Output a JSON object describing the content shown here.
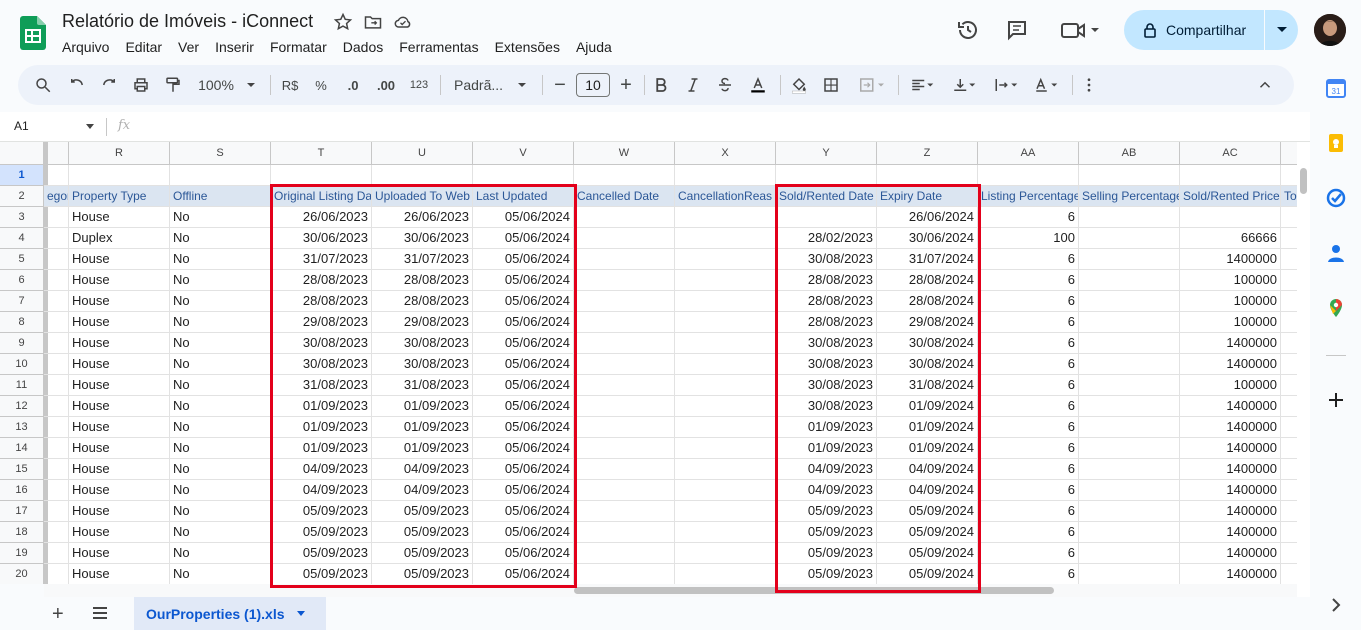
{
  "doc": {
    "title": "Relatório de Imóveis - iConnect"
  },
  "menu": [
    "Arquivo",
    "Editar",
    "Ver",
    "Inserir",
    "Formatar",
    "Dados",
    "Ferramentas",
    "Extensões",
    "Ajuda"
  ],
  "share": {
    "label": "Compartilhar"
  },
  "toolbar": {
    "zoom": "100%",
    "currency": "R$",
    "percent": "%",
    "dec_less": ".0",
    "dec_more": ".00",
    "number_format": "123",
    "font": "Padrã...",
    "font_size": "10",
    "minus": "−",
    "plus": "+"
  },
  "namebox": "A1",
  "fx": "fx",
  "columns": [
    "",
    "R",
    "S",
    "T",
    "U",
    "V",
    "W",
    "X",
    "Y",
    "Z",
    "AA",
    "AB",
    "AC"
  ],
  "header_row": [
    "egory",
    "Property Type",
    "Offline",
    "Original Listing Da",
    "Uploaded To Web",
    "Last Updated",
    "Cancelled Date",
    "CancellationReas",
    "Sold/Rented Date",
    "Expiry Date",
    "Listing Percentage",
    "Selling Percentage",
    "Sold/Rented Price",
    "To"
  ],
  "rows": [
    {
      "n": "1",
      "c": [
        "",
        "",
        "",
        "",
        "",
        "",
        "",
        "",
        "",
        "",
        "",
        "",
        ""
      ]
    },
    {
      "n": "3",
      "c": [
        "",
        "House",
        "No",
        "26/06/2023",
        "26/06/2023",
        "05/06/2024",
        "",
        "",
        "",
        "26/06/2024",
        "6",
        "",
        ""
      ]
    },
    {
      "n": "4",
      "c": [
        "",
        "Duplex",
        "No",
        "30/06/2023",
        "30/06/2023",
        "05/06/2024",
        "",
        "",
        "28/02/2023",
        "30/06/2024",
        "100",
        "",
        "66666"
      ]
    },
    {
      "n": "5",
      "c": [
        "",
        "House",
        "No",
        "31/07/2023",
        "31/07/2023",
        "05/06/2024",
        "",
        "",
        "30/08/2023",
        "31/07/2024",
        "6",
        "",
        "1400000"
      ]
    },
    {
      "n": "6",
      "c": [
        "",
        "House",
        "No",
        "28/08/2023",
        "28/08/2023",
        "05/06/2024",
        "",
        "",
        "28/08/2023",
        "28/08/2024",
        "6",
        "",
        "100000"
      ]
    },
    {
      "n": "7",
      "c": [
        "",
        "House",
        "No",
        "28/08/2023",
        "28/08/2023",
        "05/06/2024",
        "",
        "",
        "28/08/2023",
        "28/08/2024",
        "6",
        "",
        "100000"
      ]
    },
    {
      "n": "8",
      "c": [
        "",
        "House",
        "No",
        "29/08/2023",
        "29/08/2023",
        "05/06/2024",
        "",
        "",
        "28/08/2023",
        "29/08/2024",
        "6",
        "",
        "100000"
      ]
    },
    {
      "n": "9",
      "c": [
        "",
        "House",
        "No",
        "30/08/2023",
        "30/08/2023",
        "05/06/2024",
        "",
        "",
        "30/08/2023",
        "30/08/2024",
        "6",
        "",
        "1400000"
      ]
    },
    {
      "n": "10",
      "c": [
        "",
        "House",
        "No",
        "30/08/2023",
        "30/08/2023",
        "05/06/2024",
        "",
        "",
        "30/08/2023",
        "30/08/2024",
        "6",
        "",
        "1400000"
      ]
    },
    {
      "n": "11",
      "c": [
        "",
        "House",
        "No",
        "31/08/2023",
        "31/08/2023",
        "05/06/2024",
        "",
        "",
        "30/08/2023",
        "31/08/2024",
        "6",
        "",
        "100000"
      ]
    },
    {
      "n": "12",
      "c": [
        "",
        "House",
        "No",
        "01/09/2023",
        "01/09/2023",
        "05/06/2024",
        "",
        "",
        "30/08/2023",
        "01/09/2024",
        "6",
        "",
        "1400000"
      ]
    },
    {
      "n": "13",
      "c": [
        "",
        "House",
        "No",
        "01/09/2023",
        "01/09/2023",
        "05/06/2024",
        "",
        "",
        "01/09/2023",
        "01/09/2024",
        "6",
        "",
        "1400000"
      ]
    },
    {
      "n": "14",
      "c": [
        "",
        "House",
        "No",
        "01/09/2023",
        "01/09/2023",
        "05/06/2024",
        "",
        "",
        "01/09/2023",
        "01/09/2024",
        "6",
        "",
        "1400000"
      ]
    },
    {
      "n": "15",
      "c": [
        "",
        "House",
        "No",
        "04/09/2023",
        "04/09/2023",
        "05/06/2024",
        "",
        "",
        "04/09/2023",
        "04/09/2024",
        "6",
        "",
        "1400000"
      ]
    },
    {
      "n": "16",
      "c": [
        "",
        "House",
        "No",
        "04/09/2023",
        "04/09/2023",
        "05/06/2024",
        "",
        "",
        "04/09/2023",
        "04/09/2024",
        "6",
        "",
        "1400000"
      ]
    },
    {
      "n": "17",
      "c": [
        "",
        "House",
        "No",
        "05/09/2023",
        "05/09/2023",
        "05/06/2024",
        "",
        "",
        "05/09/2023",
        "05/09/2024",
        "6",
        "",
        "1400000"
      ]
    },
    {
      "n": "18",
      "c": [
        "",
        "House",
        "No",
        "05/09/2023",
        "05/09/2023",
        "05/06/2024",
        "",
        "",
        "05/09/2023",
        "05/09/2024",
        "6",
        "",
        "1400000"
      ]
    },
    {
      "n": "19",
      "c": [
        "",
        "House",
        "No",
        "05/09/2023",
        "05/09/2023",
        "05/06/2024",
        "",
        "",
        "05/09/2023",
        "05/09/2024",
        "6",
        "",
        "1400000"
      ]
    },
    {
      "n": "20",
      "c": [
        "",
        "House",
        "No",
        "05/09/2023",
        "05/09/2023",
        "05/06/2024",
        "",
        "",
        "05/09/2023",
        "05/09/2024",
        "6",
        "",
        "1400000"
      ]
    }
  ],
  "header_row_num": "2",
  "sheet_tab": {
    "name": "OurProperties (1).xls"
  },
  "colors": {
    "accent": "#0b57d0",
    "highlight_box": "#e3001b",
    "share_bg": "#c2e7ff"
  }
}
